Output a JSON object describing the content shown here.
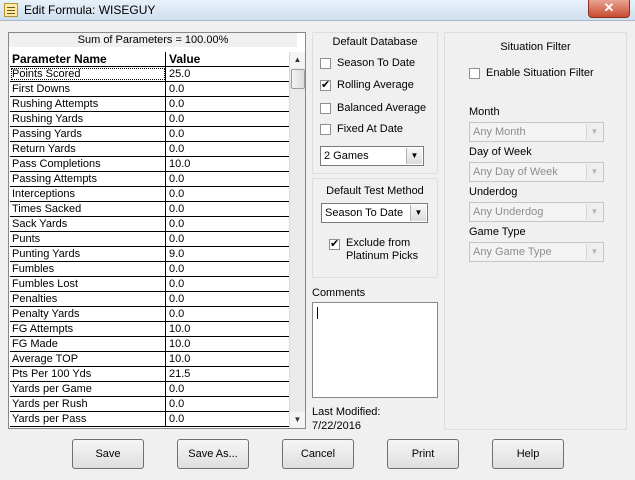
{
  "window": {
    "title": "Edit Formula:  WISEGUY",
    "close_glyph": "✕"
  },
  "table": {
    "sum_label": "Sum of Parameters = 100.00%",
    "col_name": "Parameter Name",
    "col_value": "Value",
    "rows": [
      {
        "name": "Points Scored",
        "value": "25.0"
      },
      {
        "name": "First Downs",
        "value": "0.0"
      },
      {
        "name": "Rushing Attempts",
        "value": "0.0"
      },
      {
        "name": "Rushing Yards",
        "value": "0.0"
      },
      {
        "name": "Passing Yards",
        "value": "0.0"
      },
      {
        "name": "Return Yards",
        "value": "0.0"
      },
      {
        "name": "Pass Completions",
        "value": "10.0"
      },
      {
        "name": "Passing Attempts",
        "value": "0.0"
      },
      {
        "name": "Interceptions",
        "value": "0.0"
      },
      {
        "name": "Times Sacked",
        "value": "0.0"
      },
      {
        "name": "Sack Yards",
        "value": "0.0"
      },
      {
        "name": "Punts",
        "value": "0.0"
      },
      {
        "name": "Punting Yards",
        "value": "9.0"
      },
      {
        "name": "Fumbles",
        "value": "0.0"
      },
      {
        "name": "Fumbles Lost",
        "value": "0.0"
      },
      {
        "name": "Penalties",
        "value": "0.0"
      },
      {
        "name": "Penalty Yards",
        "value": "0.0"
      },
      {
        "name": "FG Attempts",
        "value": "10.0"
      },
      {
        "name": "FG Made",
        "value": "10.0"
      },
      {
        "name": "Average TOP",
        "value": "10.0"
      },
      {
        "name": "Pts Per 100 Yds",
        "value": "21.5"
      },
      {
        "name": "Yards per Game",
        "value": "0.0"
      },
      {
        "name": "Yards per Rush",
        "value": "0.0"
      },
      {
        "name": "Yards per Pass",
        "value": "0.0"
      }
    ]
  },
  "default_database": {
    "title": "Default Database",
    "season_to_date": "Season To Date",
    "rolling_average": "Rolling Average",
    "balanced_average": "Balanced Average",
    "fixed_at_date": "Fixed At Date",
    "games_select": "2 Games"
  },
  "default_test_method": {
    "title": "Default Test Method",
    "select": "Season To Date",
    "exclude_line1": "Exclude from",
    "exclude_line2": "Platinum Picks"
  },
  "comments": {
    "label": "Comments"
  },
  "last_modified": {
    "label": "Last Modified:",
    "date": "7/22/2016"
  },
  "situation_filter": {
    "title": "Situation Filter",
    "enable_label": "Enable Situation Filter",
    "month_label": "Month",
    "month_value": "Any Month",
    "dow_label": "Day of Week",
    "dow_value": "Any Day of Week",
    "underdog_label": "Underdog",
    "underdog_value": "Any Underdog",
    "game_type_label": "Game Type",
    "game_type_value": "Any Game Type"
  },
  "buttons": {
    "save": "Save",
    "save_as": "Save As...",
    "cancel": "Cancel",
    "print": "Print",
    "help": "Help"
  },
  "icons": {
    "arrow_up": "▲",
    "arrow_down": "▼"
  }
}
